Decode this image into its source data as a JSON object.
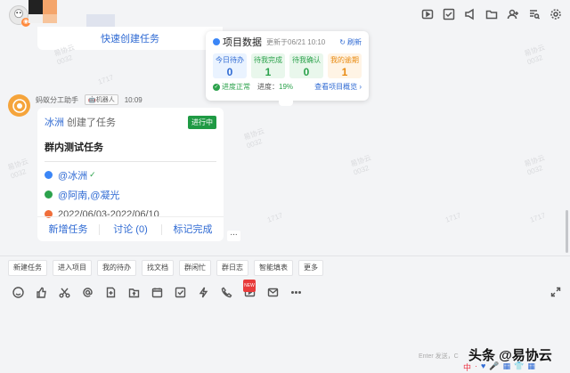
{
  "topbar": {
    "icons": [
      "video-icon",
      "check-icon",
      "announce-icon",
      "folder-icon",
      "add-user-icon",
      "search-list-icon",
      "settings-icon"
    ]
  },
  "quick_create": {
    "label": "快速创建任务"
  },
  "project_popup": {
    "title": "项目数据",
    "updated": "更新于06/21 10:10",
    "refresh": "刷新",
    "stats": [
      {
        "label": "今日待办",
        "value": "0"
      },
      {
        "label": "待我完成",
        "value": "1"
      },
      {
        "label": "待我确认",
        "value": "0"
      },
      {
        "label": "我的逾期",
        "value": "1"
      }
    ],
    "status": "进度正常",
    "progress_label": "进度：",
    "progress_value": "19%",
    "link": "查看项目概览 ›"
  },
  "message": {
    "sender": "蚂蚁分工助手",
    "tag": "机器人",
    "time": "10:09"
  },
  "task_card": {
    "creator": "冰洲",
    "action": "创建了任务",
    "status": "进行中",
    "title": "群内测试任务",
    "assignee": "@冰洲",
    "confirmers": "@阿南,@凝光",
    "dates": "2022/06/03-2022/06/10",
    "actions": [
      "新增任务",
      "讨论 (0)",
      "标记完成"
    ],
    "more": "..."
  },
  "shortcuts": [
    "新建任务",
    "进入项目",
    "我的待办",
    "找文档",
    "群闲忙",
    "群日志",
    "智能填表",
    "更多"
  ],
  "toolbar": {
    "icons": [
      "emoji-icon",
      "thumbs-up-icon",
      "scissors-icon",
      "at-icon",
      "doc-add-icon",
      "folder-upload-icon",
      "calendar-icon",
      "task-check-icon",
      "lightning-icon",
      "phone-icon",
      "video-new-icon",
      "mail-icon",
      "more-icon"
    ],
    "new_badge": "NEW"
  },
  "input_hint": "Enter 发送，C",
  "watermark": "头条 @易协云",
  "watermark_row": [
    "中",
    "·",
    "♥",
    "🎤",
    "▦",
    "👕",
    "▦"
  ],
  "colors": {
    "accent": "#2f6ad3",
    "success": "#2ca24c",
    "warning": "#e88a10",
    "status_badge": "#1f9a44"
  }
}
